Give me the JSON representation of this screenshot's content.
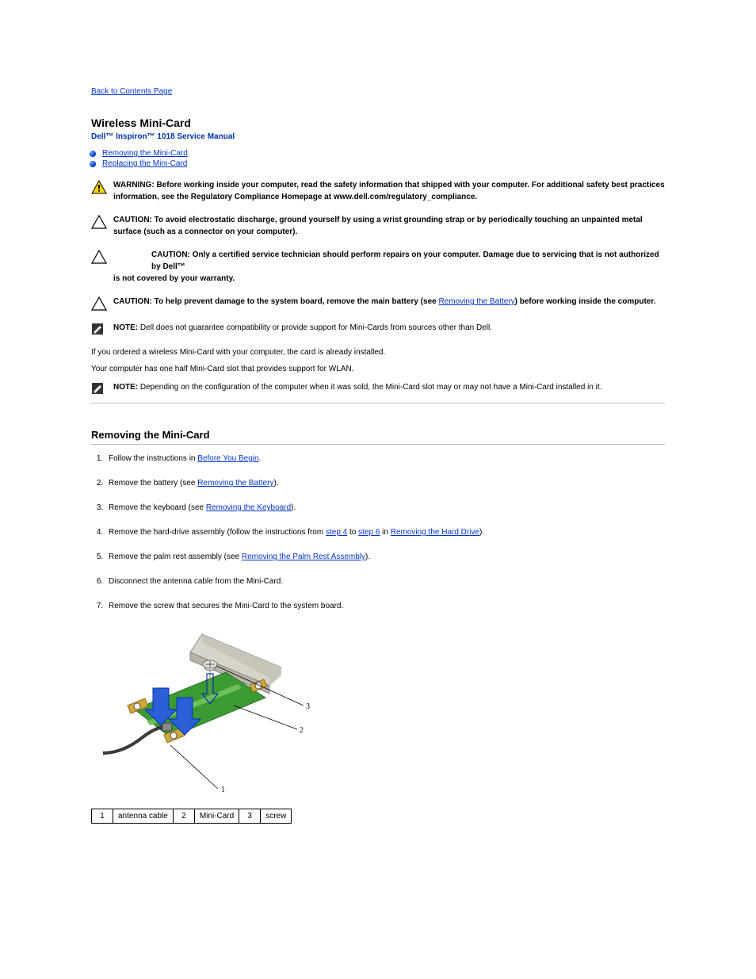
{
  "nav": {
    "back_label": "Back to Contents Page"
  },
  "header": {
    "title": "Wireless Mini-Card",
    "subtitle": "Dell™ Inspiron™ 1018 Service Manual"
  },
  "toc": {
    "link_remove": "Removing the Mini-Card",
    "link_replace": "Replacing the Mini-Card"
  },
  "warnings": {
    "warn_label": "WARNING:",
    "warn_text": "Before working inside your computer, read the safety information that shipped with your computer. For additional safety best practices information, see the Regulatory Compliance Homepage at www.dell.com/regulatory_compliance.",
    "esd_label": "CAUTION:",
    "esd_text_a": "To avoid electrostatic discharge, ground yourself by using a wrist grounding strap or by periodically touching an unpainted metal surface (such as a connector on your computer).",
    "tech_label": "CAUTION:",
    "tech_text_a": "Only a certified service technician should perform repairs on your computer. Damage due to servicing that is not authorized by Dell™",
    "tech_text_b": "is not covered by your warranty.",
    "sysboard_label": "CAUTION:",
    "sysboard_text_a": "To help prevent damage to the system board, remove the main battery (see ",
    "sysboard_link": "Removing the Battery",
    "sysboard_text_b": ") before working inside the computer.",
    "note1_label": "NOTE:",
    "note1_text": "Dell does not guarantee compatibility or provide support for Mini-Cards from sources other than Dell.",
    "intro_text": "If you ordered a wireless Mini-Card with your computer, the card is already installed.",
    "slot_text": "Your computer has one half Mini-Card slot that provides support for WLAN.",
    "note2_label": "NOTE:",
    "note2_text": "Depending on the configuration of the computer when it was sold, the Mini-Card slot may or may not have a Mini-Card installed in it."
  },
  "section": {
    "heading": "Removing the Mini-Card"
  },
  "steps": {
    "s1_a": "Follow the instructions in ",
    "s1_link": "Before You Begin",
    "s1_b": ".",
    "s2_a": "Remove the battery (see ",
    "s2_link": "Removing the Battery",
    "s2_b": ").",
    "s3_a": "Remove the keyboard (see ",
    "s3_link": "Removing the Keyboard",
    "s3_b": ").",
    "s4_a": "Remove the hard-drive assembly (follow the instructions from ",
    "s4_link_step4": "step 4",
    "s4_mid1": " to ",
    "s4_link_step6": "step 6",
    "s4_mid2": " in ",
    "s4_link_hd": "Removing the Hard Drive",
    "s4_b": ").",
    "s5_a": "Remove the palm rest assembly (see ",
    "s5_link": "Removing the Palm Rest Assembly",
    "s5_b": ").",
    "s6": "Disconnect the antenna cable from the Mini-Card.",
    "s7": "Remove the screw that secures the Mini-Card to the system board."
  },
  "callouts": {
    "c1_num": "1",
    "c1_label": "antenna cable",
    "c2_num": "2",
    "c2_label": "Mini-Card",
    "c3_num": "3",
    "c3_label": "screw"
  }
}
